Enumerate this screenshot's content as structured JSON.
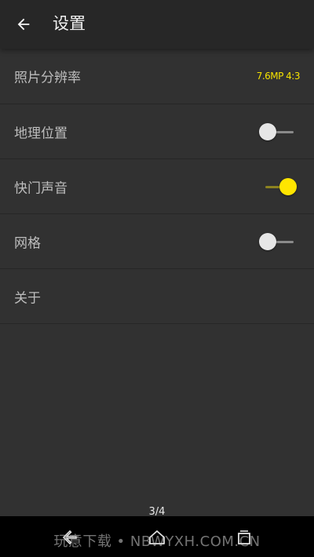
{
  "header": {
    "title": "设置"
  },
  "settings": [
    {
      "label": "照片分辨率",
      "value": "7.6MP 4:3"
    },
    {
      "label": "地理位置",
      "toggle": false
    },
    {
      "label": "快门声音",
      "toggle": true
    },
    {
      "label": "网格",
      "toggle": false
    },
    {
      "label": "关于"
    }
  ],
  "footer": {
    "page_indicator": "3/4",
    "watermark": "玩意下载 • NBWYXH.COM.CN"
  },
  "colors": {
    "accent": "#ffe500",
    "background": "#313131",
    "topbar": "#272727"
  },
  "icons": [
    "arrow-back-icon",
    "nav-back-icon",
    "nav-home-icon",
    "nav-recents-icon"
  ]
}
